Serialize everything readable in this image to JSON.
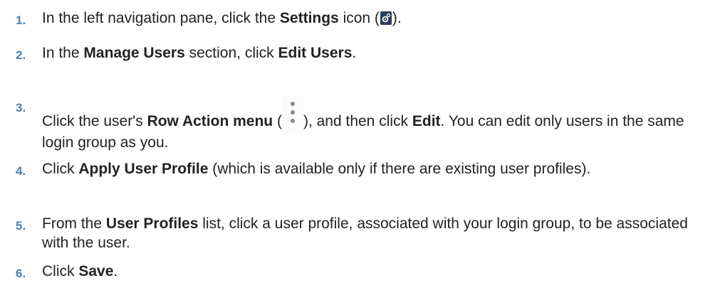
{
  "steps": [
    {
      "number": "1.",
      "parts": {
        "a": "In the left navigation pane, click the ",
        "b": "Settings",
        "c": " icon (",
        "d": ")."
      },
      "icon": "settings-gear-icon"
    },
    {
      "number": "2.",
      "parts": {
        "a": "In the ",
        "b": "Manage Users",
        "c": " section, click ",
        "d": "Edit Users",
        "e": "."
      }
    },
    {
      "number": "3.",
      "parts": {
        "a": "Click the user's ",
        "b": "Row Action menu",
        "c": " (",
        "d": "), and then click ",
        "e": "Edit",
        "f": ". You can edit only users in the same login group as you."
      },
      "icon": "kebab-menu-icon"
    },
    {
      "number": "4.",
      "parts": {
        "a": "Click ",
        "b": "Apply User Profile",
        "c": " (which is available only if there are existing user profiles)."
      }
    },
    {
      "number": "5.",
      "parts": {
        "a": "From the ",
        "b": "User Profiles",
        "c": " list, click a user profile, associated with your login group, to be associated with the user."
      }
    },
    {
      "number": "6.",
      "parts": {
        "a": "Click ",
        "b": "Save",
        "c": "."
      }
    }
  ],
  "colors": {
    "step_number": "#4a7fb0",
    "text": "#222222",
    "settings_icon_bg": "#2b3e5c"
  }
}
